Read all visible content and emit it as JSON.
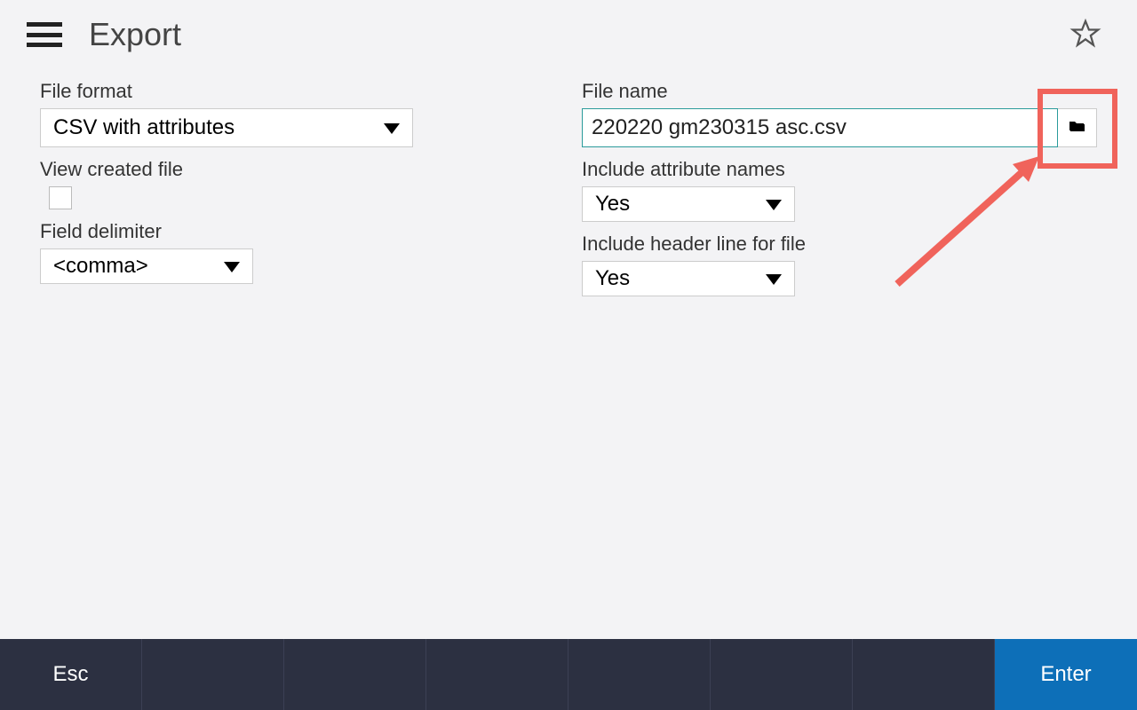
{
  "header": {
    "title": "Export"
  },
  "left": {
    "file_format": {
      "label": "File format",
      "value": "CSV with attributes"
    },
    "view_created": {
      "label": "View created file",
      "checked": false
    },
    "field_delimiter": {
      "label": "Field delimiter",
      "value": "<comma>"
    }
  },
  "right": {
    "file_name": {
      "label": "File name",
      "value": "220220 gm230315 asc.csv"
    },
    "include_attr": {
      "label": "Include attribute names",
      "value": "Yes"
    },
    "include_header": {
      "label": "Include header line for file",
      "value": "Yes"
    }
  },
  "bottom": {
    "esc": "Esc",
    "enter": "Enter"
  },
  "colors": {
    "accent_input_border": "#2b9b9b",
    "enter_bg": "#0d6fb8",
    "bar_bg": "#2c3041",
    "annotation": "#f0635b"
  }
}
